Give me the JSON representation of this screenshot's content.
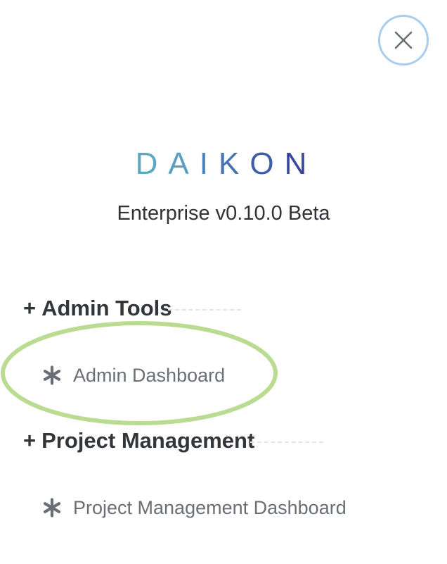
{
  "close": {
    "icon": "close-icon"
  },
  "brand": {
    "letters": [
      "D",
      "A",
      "I",
      "K",
      "O",
      "N"
    ],
    "letter_colors": [
      "#5aa9c1",
      "#5a9dc2",
      "#4d86bd",
      "#4672b4",
      "#3f5ea9",
      "#38489c"
    ]
  },
  "version": "Enterprise v0.10.0 Beta",
  "sections": [
    {
      "expander": "+",
      "title": "Admin Tools",
      "items": [
        {
          "icon": "asterisk-icon",
          "label": "Admin Dashboard"
        }
      ]
    },
    {
      "expander": "+",
      "title": "Project Management",
      "items": [
        {
          "icon": "asterisk-icon",
          "label": "Project Management Dashboard"
        }
      ]
    }
  ],
  "colors": {
    "highlight": "#b9dc92",
    "close_ring": "#a9cdee",
    "heading": "#32363b",
    "item": "#6a6f75"
  }
}
